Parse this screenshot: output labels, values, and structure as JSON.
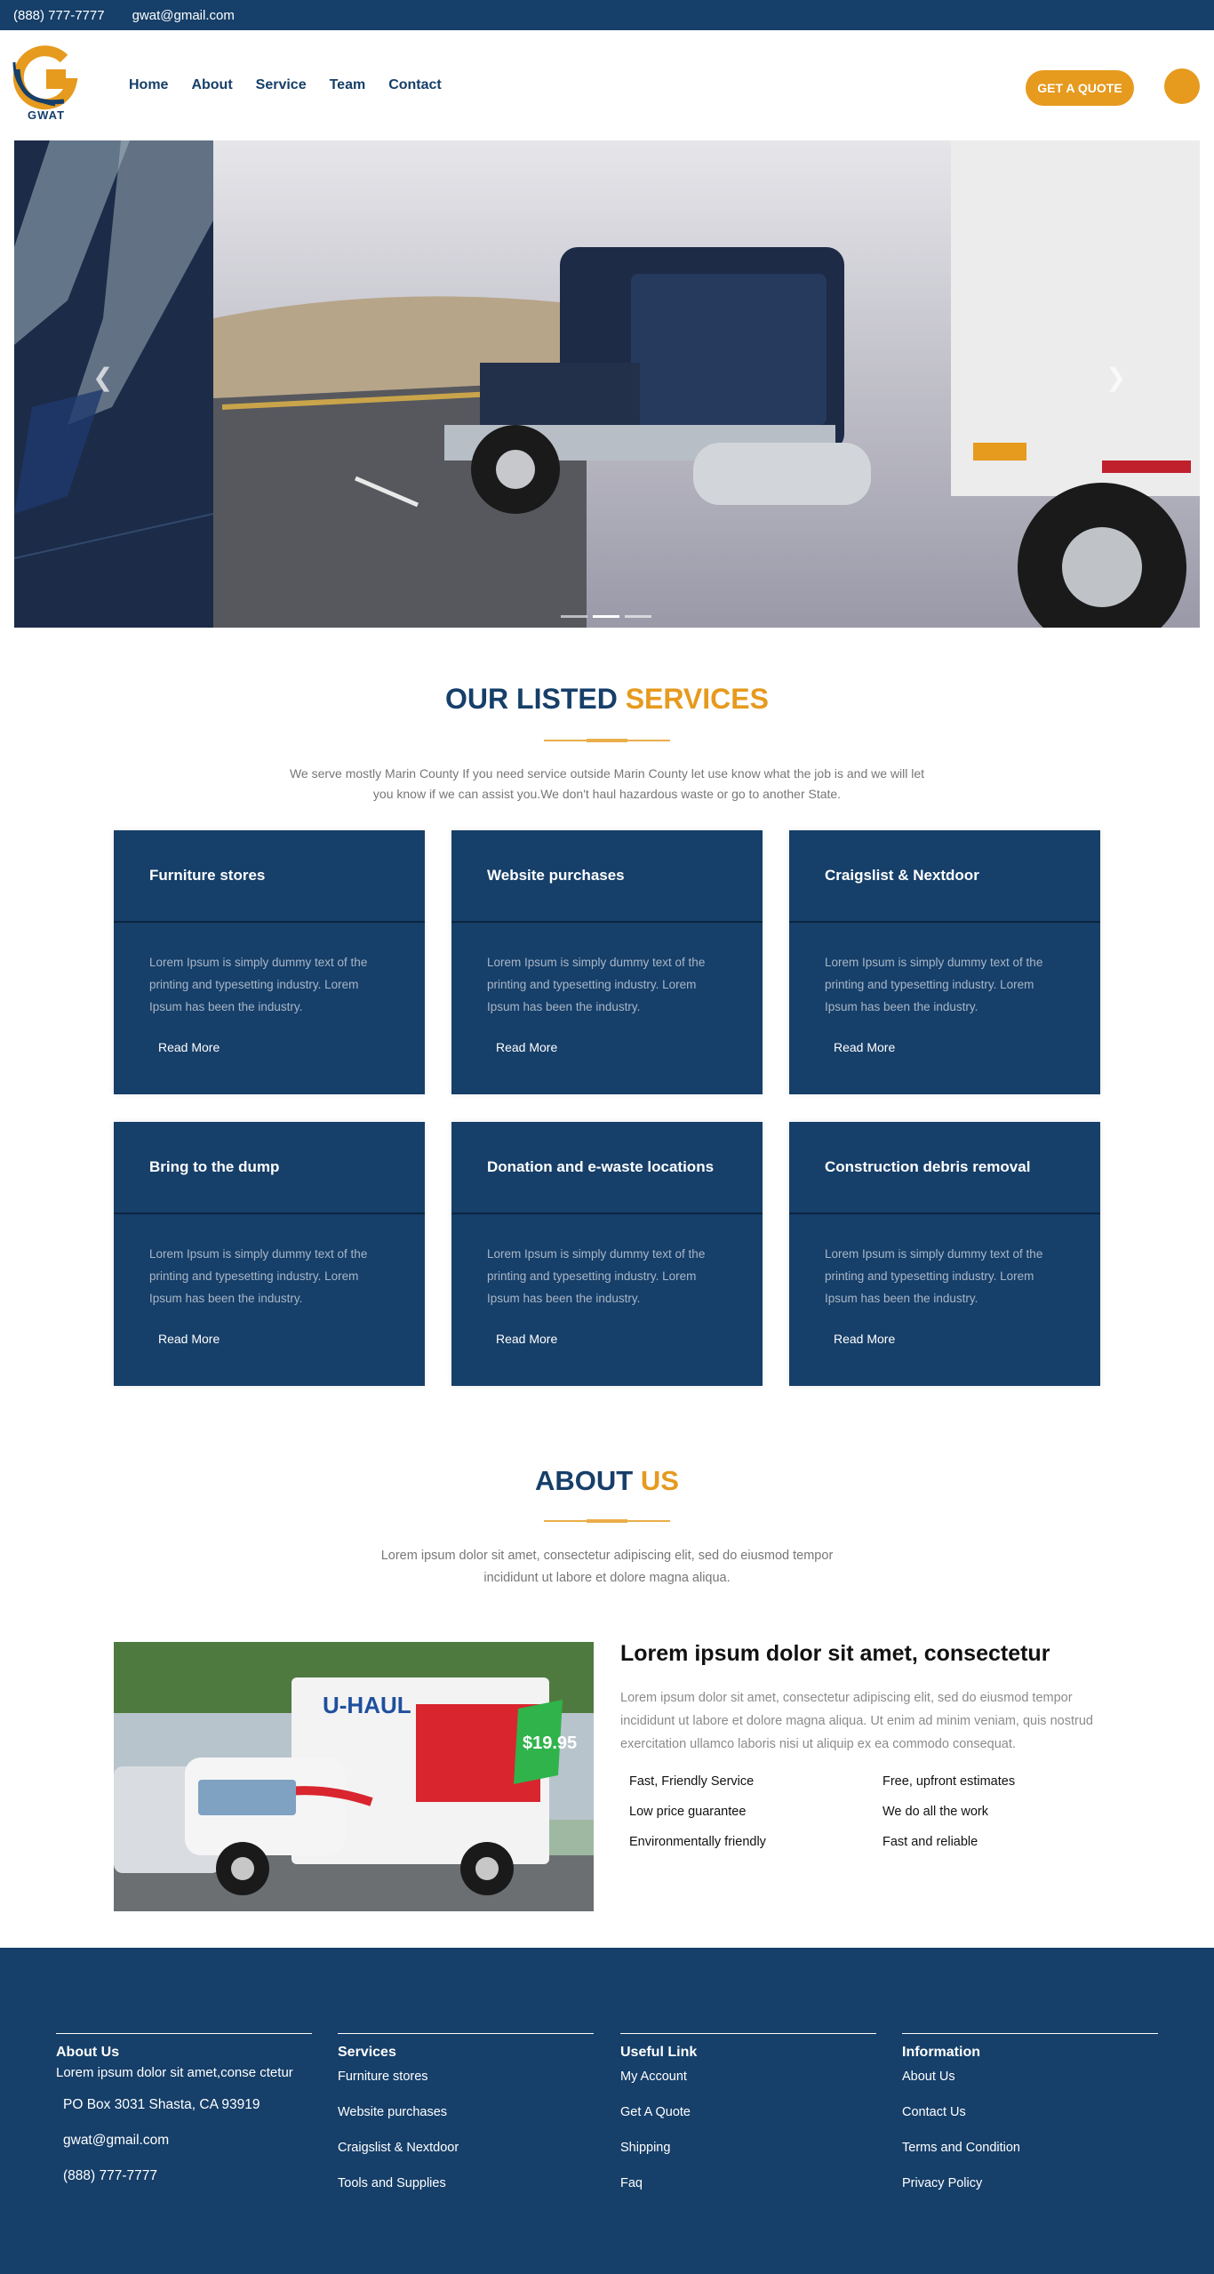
{
  "topbar": {
    "phone": "(888) 777-7777",
    "email": "gwat@gmail.com"
  },
  "header": {
    "logo_text": "GWAT",
    "nav": [
      "Home",
      "About",
      "Service",
      "Team",
      "Contact"
    ],
    "quote_button": "GET A QUOTE"
  },
  "hero": {
    "prev_icon": "chevron-left-icon",
    "next_icon": "chevron-right-icon",
    "slides": 3,
    "active_slide": 2
  },
  "services": {
    "title_a": "OUR LISTED",
    "title_b": "SERVICES",
    "description": "We serve mostly Marin County If you need service outside Marin County let use know what the job is and we will let you know if we can assist you.We don't haul hazardous waste or go to another State.",
    "cards": [
      {
        "title": "Furniture stores",
        "text": "Lorem Ipsum is simply dummy text of the printing and typesetting industry. Lorem Ipsum has been the industry.",
        "button": "Read More"
      },
      {
        "title": "Website purchases",
        "text": "Lorem Ipsum is simply dummy text of the printing and typesetting industry. Lorem Ipsum has been the industry.",
        "button": "Read More"
      },
      {
        "title": "Craigslist & Nextdoor",
        "text": "Lorem Ipsum is simply dummy text of the printing and typesetting industry. Lorem Ipsum has been the industry.",
        "button": "Read More"
      },
      {
        "title": "Bring to the dump",
        "text": "Lorem Ipsum is simply dummy text of the printing and typesetting industry. Lorem Ipsum has been the industry.",
        "button": "Read More"
      },
      {
        "title": "Donation and e-waste locations",
        "text": "Lorem Ipsum is simply dummy text of the printing and typesetting industry. Lorem Ipsum has been the industry.",
        "button": "Read More"
      },
      {
        "title": "Construction debris removal",
        "text": "Lorem Ipsum is simply dummy text of the printing and typesetting industry. Lorem Ipsum has been the industry.",
        "button": "Read More"
      }
    ]
  },
  "about": {
    "title_a": "ABOUT",
    "title_b": "US",
    "description": "Lorem ipsum dolor sit amet, consectetur adipiscing elit, sed do eiusmod tempor incididunt ut labore et dolore magna aliqua.",
    "heading": "Lorem ipsum dolor sit amet, consectetur",
    "paragraph": "Lorem ipsum dolor sit amet, consectetur adipiscing elit, sed do eiusmod tempor incididunt ut labore et dolore magna aliqua. Ut enim ad minim veniam, quis nostrud exercitation ullamco laboris nisi ut aliquip ex ea commodo consequat.",
    "features": [
      "Fast, Friendly Service",
      "Free, upfront estimates",
      "Low price guarantee",
      "We do all the work",
      "Environmentally friendly",
      "Fast and reliable"
    ],
    "truck_brand": "U-HAUL",
    "truck_price": "$19.95"
  },
  "footer": {
    "about": {
      "title": "About Us",
      "text": "Lorem ipsum dolor sit amet,conse ctetur",
      "address": "PO Box 3031 Shasta, CA 93919",
      "email": "gwat@gmail.com",
      "phone": "(888) 777-7777"
    },
    "services": {
      "title": "Services",
      "links": [
        "Furniture stores",
        "Website purchases",
        "Craigslist & Nextdoor",
        "Tools and Supplies"
      ]
    },
    "useful": {
      "title": "Useful Link",
      "links": [
        "My Account",
        "Get A Quote",
        "Shipping",
        "Faq"
      ]
    },
    "info": {
      "title": "Information",
      "links": [
        "About Us",
        "Contact Us",
        "Terms and Condition",
        "Privacy Policy"
      ]
    }
  },
  "colors": {
    "navy": "#163f69",
    "orange": "#e69a1e"
  }
}
